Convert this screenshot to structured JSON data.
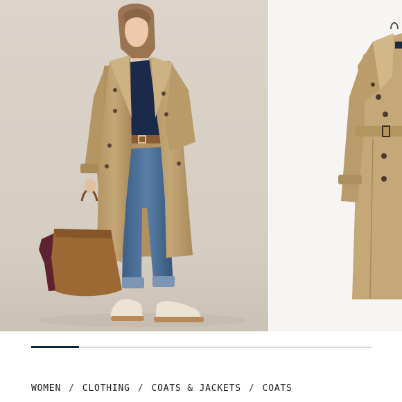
{
  "carousel": {
    "progress_fraction": 0.14,
    "colors": {
      "progress_fill": "#0d2340",
      "progress_track": "#d9d9d9",
      "photo_background": "#ddd6cc",
      "coat": "#c2a574"
    }
  },
  "breadcrumb": {
    "separator": "/",
    "items": [
      {
        "label": "WOMEN"
      },
      {
        "label": "CLOTHING"
      },
      {
        "label": "COATS & JACKETS"
      },
      {
        "label": "COATS"
      }
    ]
  }
}
